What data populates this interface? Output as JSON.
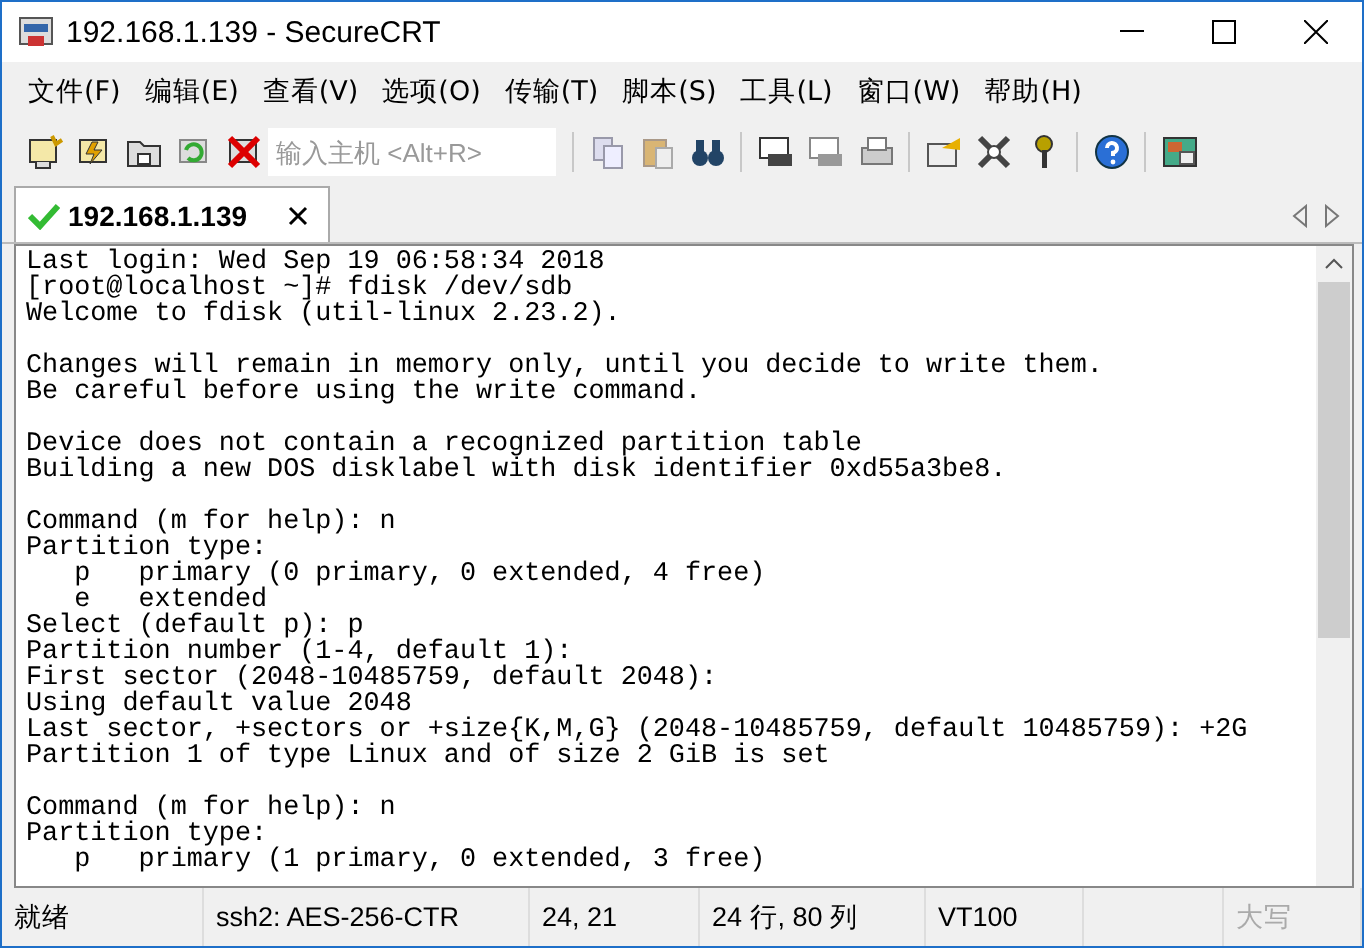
{
  "window": {
    "title": "192.168.1.139 - SecureCRT"
  },
  "menu": [
    "文件(F)",
    "编辑(E)",
    "查看(V)",
    "选项(O)",
    "传输(T)",
    "脚本(S)",
    "工具(L)",
    "窗口(W)",
    "帮助(H)"
  ],
  "toolbar": {
    "host_field": {
      "placeholder": "输入主机 <Alt+R>"
    }
  },
  "tabs": [
    {
      "label": "192.168.1.139",
      "selected": true,
      "connected": true
    }
  ],
  "terminal": {
    "blocks": [
      [
        "Last login: Wed Sep 19 06:58:34 2018",
        "[root@localhost ~]# fdisk /dev/sdb",
        "Welcome to fdisk (util-linux 2.23.2)."
      ],
      [
        "Changes will remain in memory only, until you decide to write them.",
        "Be careful before using the write command."
      ],
      [
        "Device does not contain a recognized partition table",
        "Building a new DOS disklabel with disk identifier 0xd55a3be8."
      ],
      [
        "Command (m for help): n",
        "Partition type:",
        "   p   primary (0 primary, 0 extended, 4 free)",
        "   e   extended",
        "Select (default p): p",
        "Partition number (1-4, default 1):",
        "First sector (2048-10485759, default 2048):",
        "Using default value 2048",
        "Last sector, +sectors or +size{K,M,G} (2048-10485759, default 10485759): +2G",
        "Partition 1 of type Linux and of size 2 GiB is set"
      ],
      [
        "Command (m for help): n",
        "Partition type:",
        "   p   primary (1 primary, 0 extended, 3 free)"
      ]
    ]
  },
  "status_bar": [
    "就绪",
    "ssh2: AES-256-CTR",
    "24,  21",
    "24 行, 80 列",
    "VT100",
    "大写"
  ]
}
